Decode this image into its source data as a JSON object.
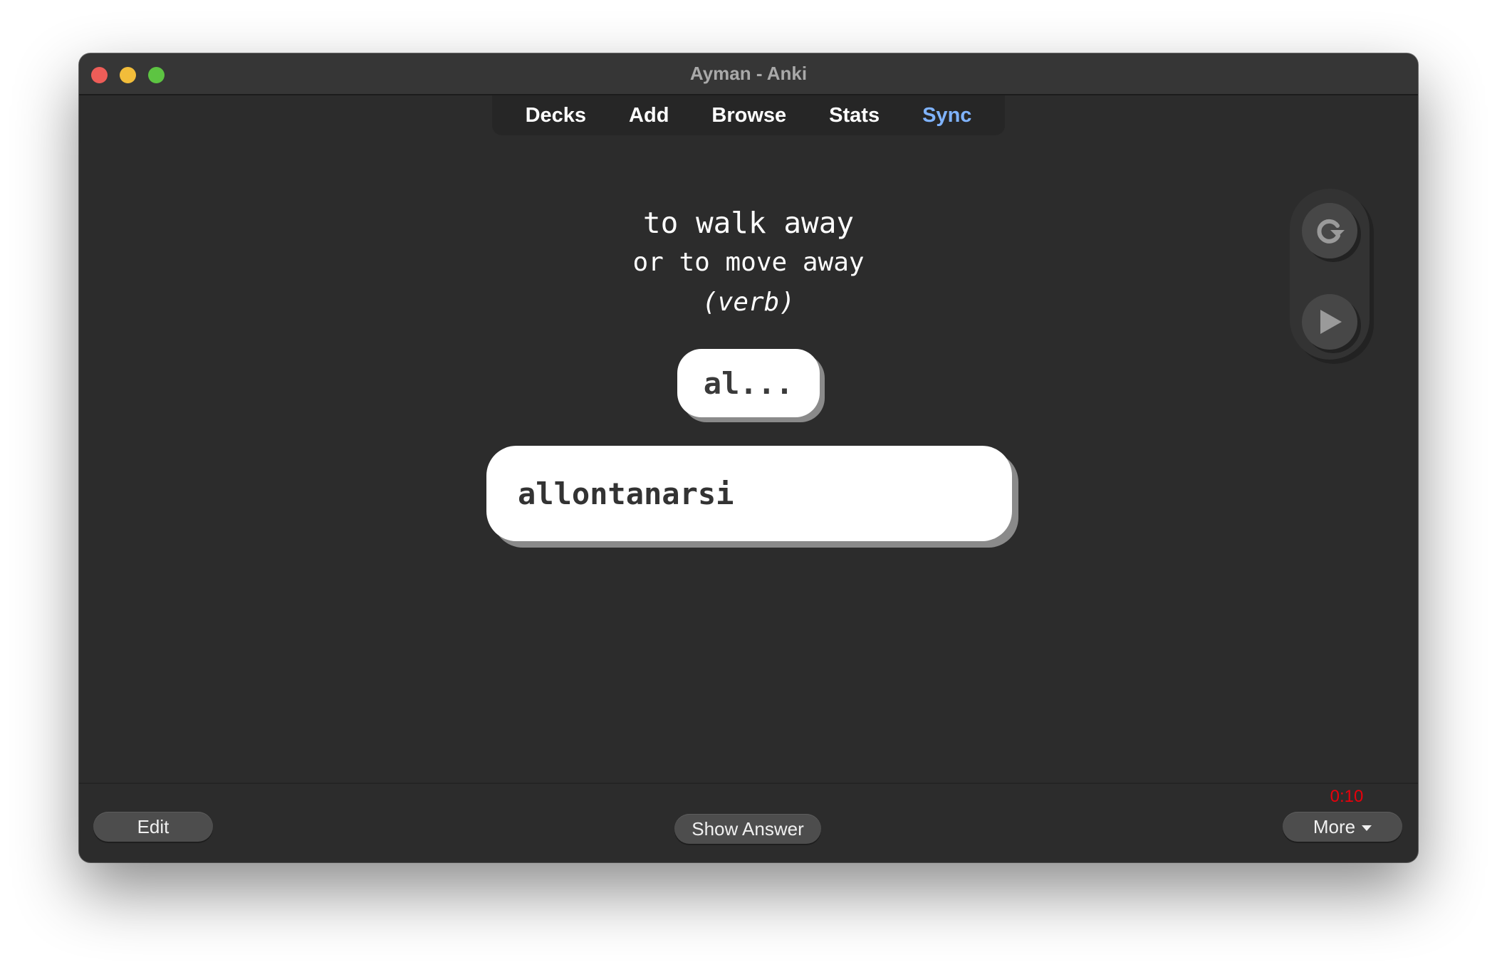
{
  "window": {
    "title": "Ayman - Anki",
    "controls": [
      "close",
      "minimize",
      "zoom"
    ]
  },
  "toolbar": {
    "items": [
      {
        "label": "Decks"
      },
      {
        "label": "Add"
      },
      {
        "label": "Browse"
      },
      {
        "label": "Stats"
      },
      {
        "label": "Sync",
        "highlighted": true,
        "color": "#7fb3ff"
      }
    ]
  },
  "card": {
    "front_line1": "to walk away",
    "front_line2": "or to move away",
    "front_line3": "(verb)",
    "hint": "al...",
    "answer_value": "allontanarsi"
  },
  "side_controls": {
    "replay_icon": "replay-icon",
    "play_icon": "play-icon"
  },
  "bottom_bar": {
    "edit_label": "Edit",
    "show_answer_label": "Show Answer",
    "more_label": "More",
    "timer": "0:10",
    "timer_color": "#e8000b"
  }
}
